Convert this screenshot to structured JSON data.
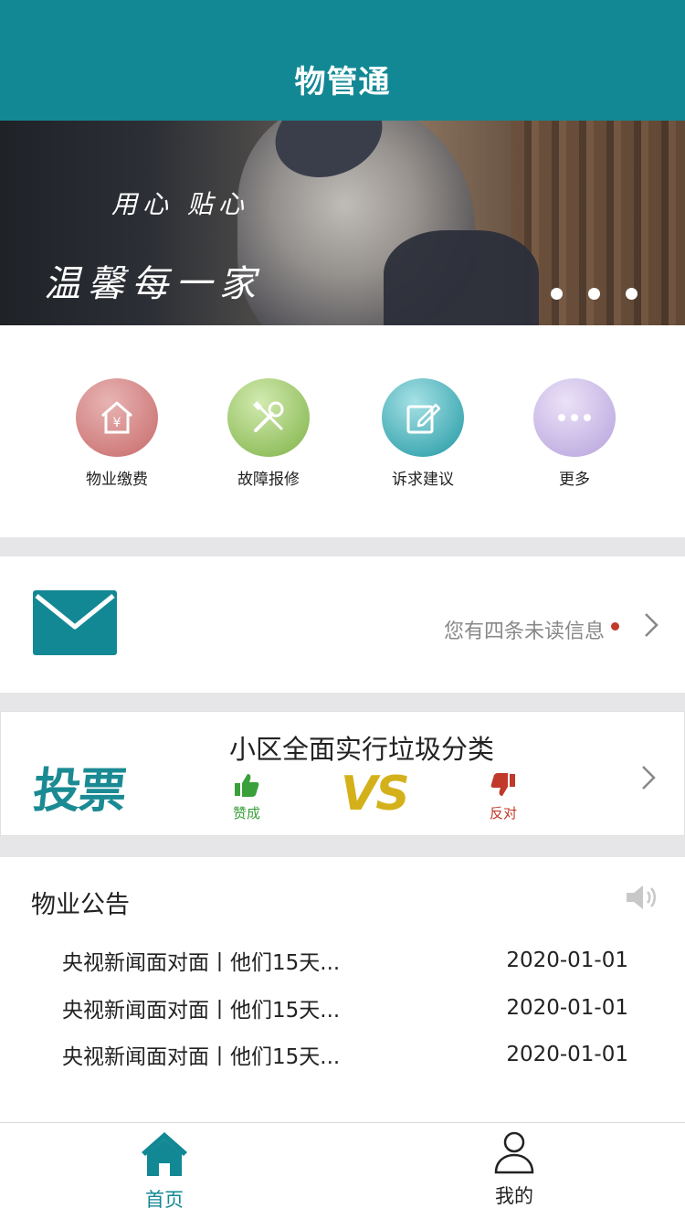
{
  "header": {
    "title": "物管通"
  },
  "banner": {
    "line1": "用心 贴心",
    "line2": "温馨每一家",
    "dot_count": 3
  },
  "quick_actions": [
    {
      "label": "物业缴费",
      "icon": "payment-house-icon",
      "color_from": "#e3a7a6",
      "color_to": "#c9706f"
    },
    {
      "label": "故障报修",
      "icon": "repair-tools-icon",
      "color_from": "#c5e2a0",
      "color_to": "#86b84e"
    },
    {
      "label": "诉求建议",
      "icon": "edit-note-icon",
      "color_from": "#98dbe0",
      "color_to": "#2aa3ad"
    },
    {
      "label": "更多",
      "icon": "more-dots-icon",
      "color_from": "#e6dbf5",
      "color_to": "#b9a6de"
    }
  ],
  "messages": {
    "text": "您有四条未读信息"
  },
  "vote": {
    "logo_text": "投票",
    "title": "小区全面实行垃圾分类",
    "vs_text": "VS",
    "agree_label": "赞成",
    "disagree_label": "反对"
  },
  "notice": {
    "title": "物业公告",
    "items": [
      {
        "title": "央视新闻面对面丨他们15天...",
        "date": "2020-01-01"
      },
      {
        "title": "央视新闻面对面丨他们15天...",
        "date": "2020-01-01"
      },
      {
        "title": "央视新闻面对面丨他们15天...",
        "date": "2020-01-01"
      }
    ]
  },
  "tabbar": {
    "home_label": "首页",
    "mine_label": "我的"
  },
  "colors": {
    "primary": "#128894",
    "agree": "#3aa03a",
    "disagree": "#c0392b",
    "vs": "#d4b11a"
  }
}
